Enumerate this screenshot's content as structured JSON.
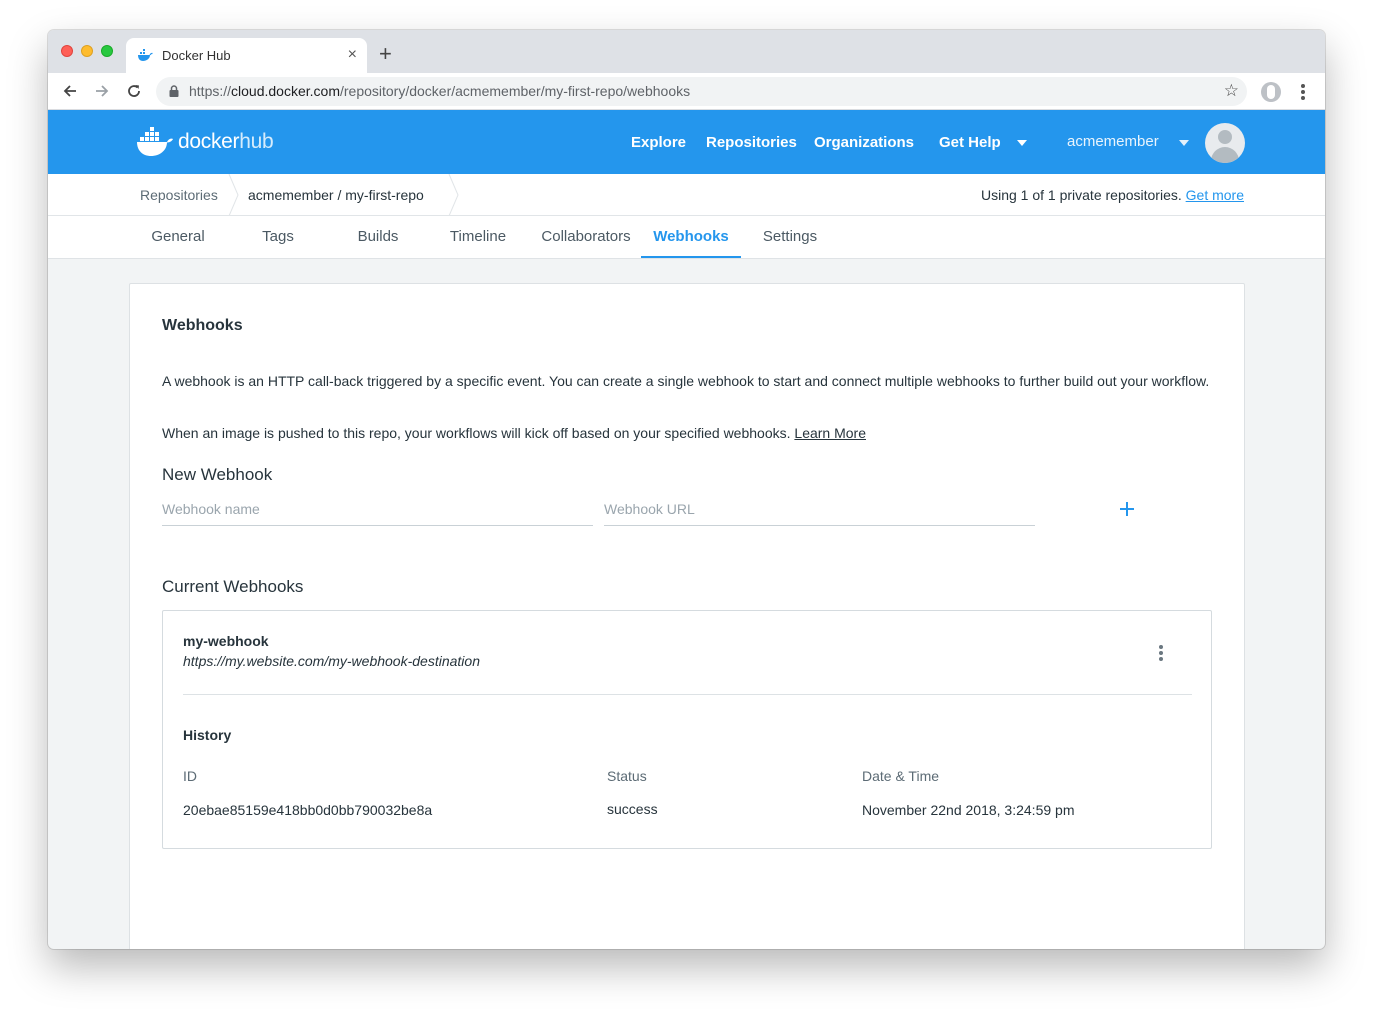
{
  "browser": {
    "tab_title": "Docker Hub",
    "tab_close": "×",
    "new_tab": "+",
    "url_prefix": "https://",
    "url_host": "cloud.docker.com",
    "url_path": "/repository/docker/acmemember/my-first-repo/webhooks",
    "star_icon": "☆"
  },
  "header": {
    "logo_docker": "docker",
    "logo_hub": "hub",
    "nav": {
      "explore": "Explore",
      "repositories": "Repositories",
      "organizations": "Organizations",
      "get_help": "Get Help"
    },
    "username": "acmemember",
    "brand_color": "#2496ed"
  },
  "breadcrumb": {
    "root": "Repositories",
    "current": "acmemember / my-first-repo",
    "usage_text": "Using 1 of 1 private repositories.",
    "usage_link": "Get more"
  },
  "tabs": {
    "general": "General",
    "tags": "Tags",
    "builds": "Builds",
    "timeline": "Timeline",
    "collaborators": "Collaborators",
    "webhooks": "Webhooks",
    "settings": "Settings",
    "active": "Webhooks"
  },
  "main": {
    "title": "Webhooks",
    "description_1": "A webhook is an HTTP call-back triggered by a specific event. You can create a single webhook to start and connect multiple webhooks to further build out your workflow.",
    "description_2": "When an image is pushed to this repo, your workflows will kick off based on your specified webhooks.",
    "learn_more": "Learn More",
    "new_webhook": {
      "title": "New Webhook",
      "name_placeholder": "Webhook name",
      "url_placeholder": "Webhook URL"
    },
    "current_webhooks": {
      "title": "Current Webhooks",
      "webhooks": [
        {
          "name": "my-webhook",
          "url": "https://my.website.com/my-webhook-destination",
          "history_title": "History",
          "columns": [
            "ID",
            "Status",
            "Date & Time"
          ],
          "history": [
            {
              "id": "20ebae85159e418bb0d0bb790032be8a",
              "status": "success",
              "datetime": "November 22nd 2018, 3:24:59 pm"
            }
          ]
        }
      ]
    }
  }
}
